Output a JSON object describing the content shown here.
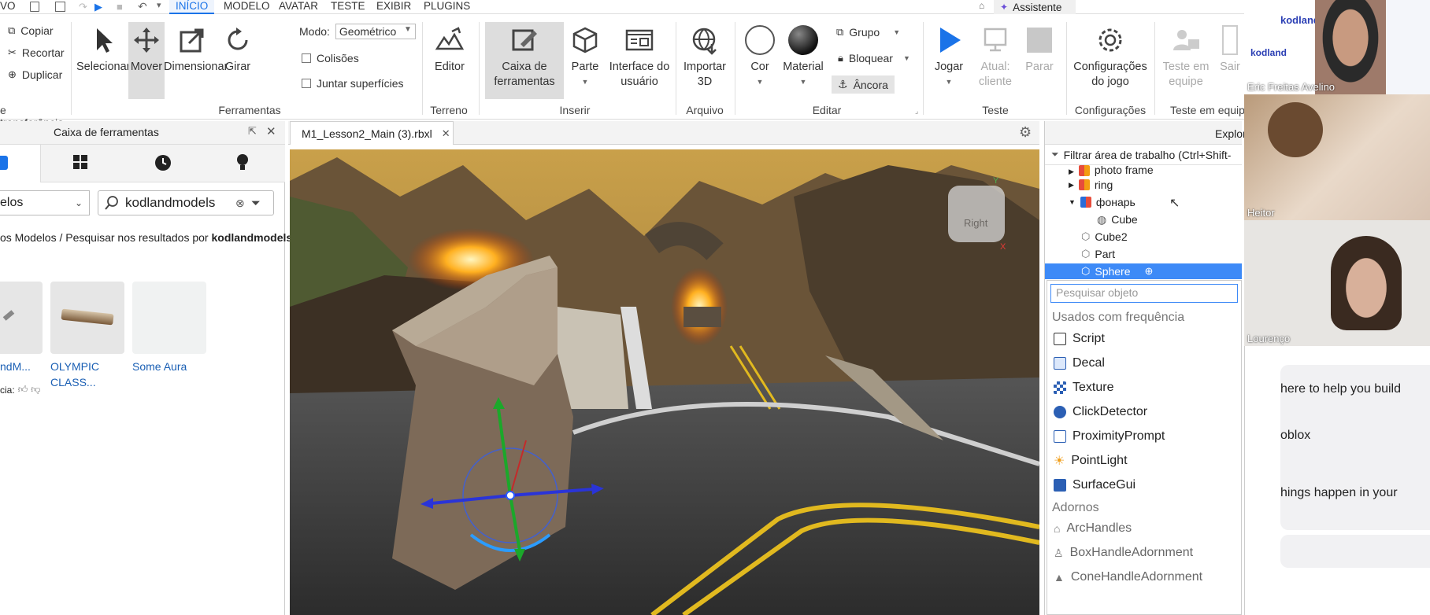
{
  "menubar": {
    "items": [
      "VO",
      "INÍCIO",
      "MODELO",
      "AVATAR",
      "TESTE",
      "EXIBIR",
      "PLUGINS"
    ],
    "assistant": "Assistente"
  },
  "ribbon": {
    "clipboard": {
      "copy": "Copiar",
      "cut": "Recortar",
      "duplicate": "Duplicar",
      "group": "e transferência"
    },
    "tools": {
      "select": "Selecionar",
      "move": "Mover",
      "scale": "Dimensionar",
      "rotate": "Girar",
      "mode_label": "Modo:",
      "mode_value": "Geométrico",
      "collisions": "Colisões",
      "join": "Juntar superfícies",
      "group": "Ferramentas"
    },
    "terrain": {
      "editor": "Editor",
      "group": "Terreno"
    },
    "insert": {
      "toolbox": "Caixa de ferramentas",
      "part": "Parte",
      "ui": "Interface do usuário",
      "group": "Inserir"
    },
    "file": {
      "import": "Importar 3D",
      "group": "Arquivo"
    },
    "edit": {
      "color": "Cor",
      "material": "Material",
      "group_btn": "Grupo",
      "lock": "Bloquear",
      "anchor": "Âncora",
      "group": "Editar"
    },
    "test": {
      "play": "Jogar",
      "current": "Atual: cliente",
      "stop": "Parar",
      "group": "Teste"
    },
    "settings": {
      "game": "Configurações do jogo",
      "group": "Configurações"
    },
    "team": {
      "team_test": "Teste em equipe",
      "exit": "Sair",
      "group": "Teste em equip"
    }
  },
  "toolbox": {
    "title": "Caixa de ferramentas",
    "category": "elos",
    "search_value": "kodlandmodels",
    "breadcrumb_prefix": "os Modelos / Pesquisar nos resultados por ",
    "breadcrumb_term": "kodlandmodels",
    "items": [
      {
        "label": "ndM..."
      },
      {
        "label": "OLYMPIC CLASS..."
      },
      {
        "label": "Some Aura"
      }
    ],
    "rating_label": "cia:"
  },
  "viewport": {
    "tab": "M1_Lesson2_Main (3).rbxl",
    "cube_label": "Right",
    "axis_y": "Y",
    "axis_x": "X"
  },
  "explorer": {
    "title": "Explor",
    "filter": "Filtrar área de trabalho (Ctrl+Shift-",
    "tree": [
      {
        "label": "photo frame"
      },
      {
        "label": "ring"
      },
      {
        "label": "фонарь"
      },
      {
        "label": "Cube"
      },
      {
        "label": "Cube2"
      },
      {
        "label": "Part"
      },
      {
        "label": "Sphere"
      }
    ],
    "search_placeholder": "Pesquisar objeto",
    "frequent_header": "Usados com frequência",
    "frequent": [
      "Script",
      "Decal",
      "Texture",
      "ClickDetector",
      "ProximityPrompt",
      "PointLight",
      "SurfaceGui"
    ],
    "adorn_header": "Adornos",
    "adorns": [
      "ArcHandles",
      "BoxHandleAdornment",
      "ConeHandleAdornment"
    ]
  },
  "video": {
    "participants": [
      "Eric Freitas Avelino",
      "Heitor",
      "Lourenço"
    ],
    "brand": "kodland"
  },
  "assistant": {
    "lines": [
      "here to help you build",
      "oblox",
      "hings happen in your"
    ]
  }
}
